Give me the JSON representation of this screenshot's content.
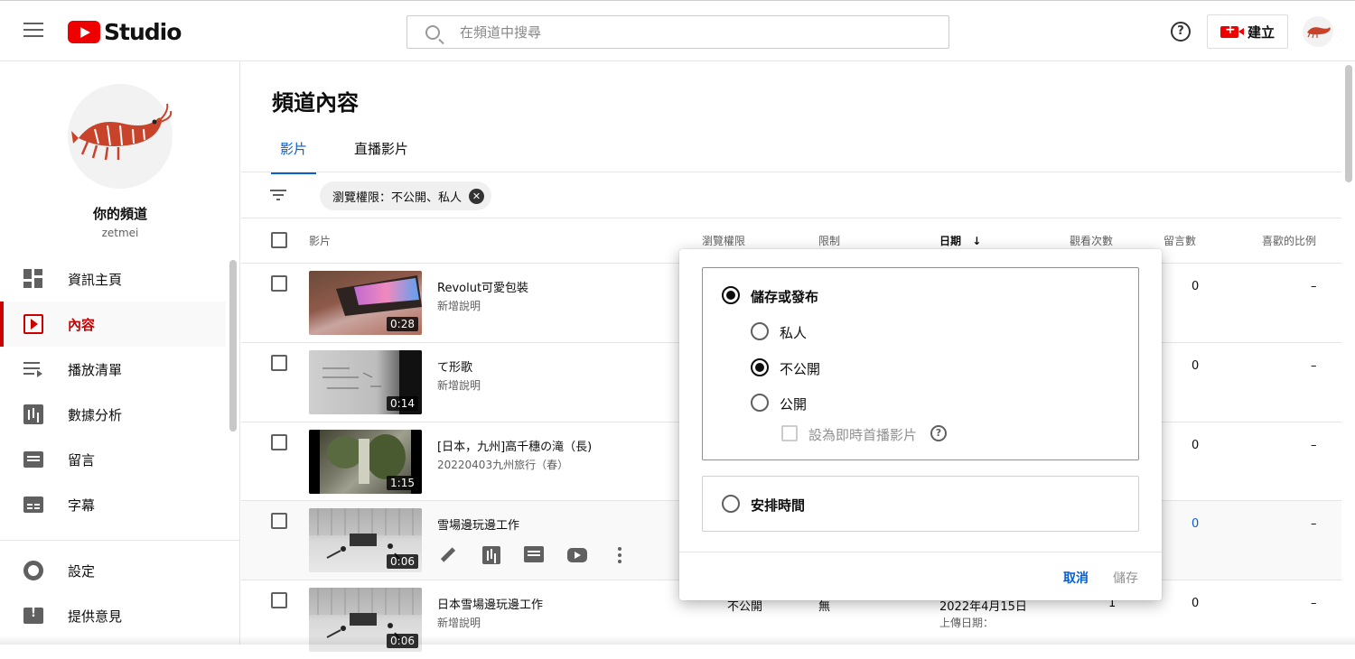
{
  "header": {
    "logo_text": "Studio",
    "search_placeholder": "在頻道中搜尋",
    "help_glyph": "?",
    "create_label": "建立"
  },
  "sidebar": {
    "channel_name": "你的頻道",
    "channel_handle": "zetmei",
    "items": [
      {
        "label": "資訊主頁"
      },
      {
        "label": "內容"
      },
      {
        "label": "播放清單"
      },
      {
        "label": "數據分析"
      },
      {
        "label": "留言"
      },
      {
        "label": "字幕"
      },
      {
        "label": "設定"
      },
      {
        "label": "提供意見"
      }
    ]
  },
  "main": {
    "page_title": "頻道內容",
    "tabs": [
      {
        "label": "影片"
      },
      {
        "label": "直播影片"
      }
    ],
    "filter_chip": "瀏覽權限：不公開、私人",
    "chip_close": "✕",
    "columns": [
      "影片",
      "瀏覽權限",
      "限制",
      "日期",
      "觀看次數",
      "留言數",
      "喜歡的比例"
    ],
    "sort_arrow": "↓",
    "rows": [
      {
        "title": "Revolut可愛包裝",
        "desc": "新增說明",
        "duration": "0:28",
        "comments": "0",
        "likes": "–"
      },
      {
        "title": "て形歌",
        "desc": "新增說明",
        "duration": "0:14",
        "comments": "0",
        "likes": "–"
      },
      {
        "title": "[日本，九州]高千穗の滝（長)",
        "desc": "20220403九州旅行（春）",
        "duration": "1:15",
        "comments": "0",
        "likes": "–"
      },
      {
        "title": "雪場邊玩邊工作",
        "desc": "",
        "duration": "0:06",
        "comments": "0",
        "likes": "–"
      },
      {
        "title": "日本雪場邊玩邊工作",
        "desc": "新增說明",
        "duration": "0:06",
        "comments": "0",
        "likes": "–",
        "visibility": "不公開",
        "restriction": "無",
        "date": "2022年4月15日",
        "date_sub": "上傳日期：",
        "views": "1"
      }
    ]
  },
  "popup": {
    "save_or_publish": "儲存或發布",
    "option_private": "私人",
    "option_unlisted": "不公開",
    "option_public": "公開",
    "premiere_label": "設為即時首播影片",
    "premiere_help": "?",
    "schedule": "安排時間",
    "cancel": "取消",
    "save": "儲存"
  }
}
